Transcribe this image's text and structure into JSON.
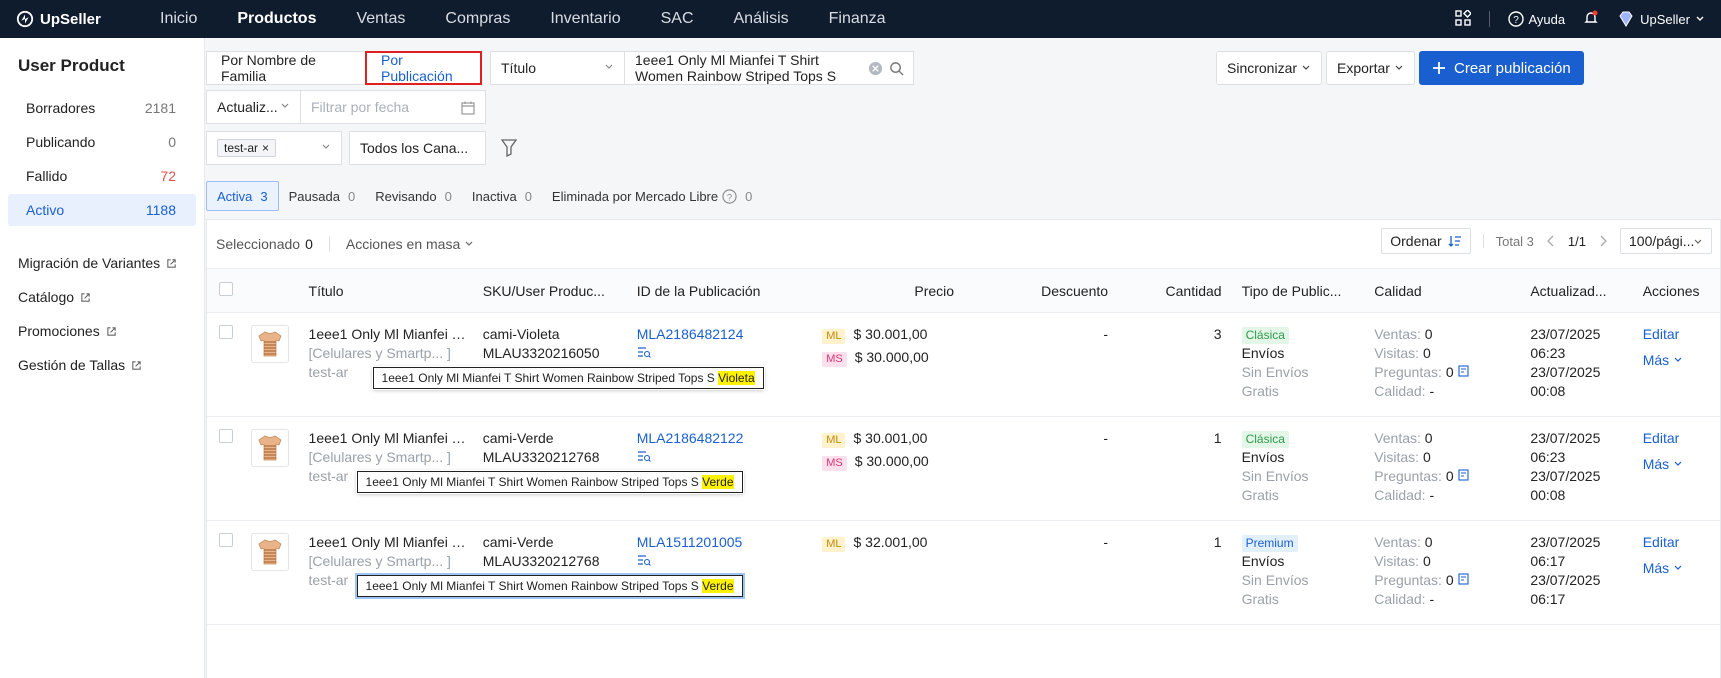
{
  "topbar": {
    "brand": "UpSeller",
    "nav": [
      "Inicio",
      "Productos",
      "Ventas",
      "Compras",
      "Inventario",
      "SAC",
      "Análisis",
      "Finanza"
    ],
    "active_nav": "Productos",
    "help": "Ayuda",
    "account": "UpSeller"
  },
  "sidebar": {
    "title": "User Product",
    "items": [
      {
        "label": "Borradores",
        "count": "2181"
      },
      {
        "label": "Publicando",
        "count": "0"
      },
      {
        "label": "Fallido",
        "count": "72"
      },
      {
        "label": "Activo",
        "count": "1188"
      }
    ],
    "links": [
      "Migración de Variantes",
      "Catálogo",
      "Promociones",
      "Gestión de Tallas"
    ]
  },
  "filters": {
    "toggle_family": "Por Nombre de Familia",
    "toggle_publication": "Por Publicación",
    "search_field": "Título",
    "search_value": "1eee1 Only Ml Mianfei T Shirt Women Rainbow Striped Tops S",
    "date_field": "Actualiz...",
    "date_placeholder": "Filtrar por fecha",
    "store_tag": "test-ar",
    "channel": "Todos los Cana..."
  },
  "actions": {
    "sync": "Sincronizar",
    "export": "Exportar",
    "create": "Crear publicación"
  },
  "tabs": [
    {
      "label": "Activa",
      "count": "3"
    },
    {
      "label": "Pausada",
      "count": "0"
    },
    {
      "label": "Revisando",
      "count": "0"
    },
    {
      "label": "Inactiva",
      "count": "0"
    },
    {
      "label": "Eliminada por Mercado Libre",
      "count": "0"
    }
  ],
  "toolbar": {
    "selected_label": "Seleccionado",
    "selected_count": "0",
    "bulk": "Acciones en masa",
    "order": "Ordenar",
    "total": "Total 3",
    "page": "1/1",
    "page_size": "100/pági..."
  },
  "table": {
    "columns": [
      "Título",
      "SKU/User Produc...",
      "ID de la Publicación",
      "Precio",
      "Descuento",
      "Cantidad",
      "Tipo de Public...",
      "Calidad",
      "Actualizad...",
      "Acciones"
    ],
    "rows": [
      {
        "title": "1eee1 Only Ml Mianfei T Shirt Women Rainbow Striped Tops S Violeta",
        "category": "[Celulares y Smartp... ]",
        "store": "test-ar",
        "sku": "cami-Violeta",
        "up_id": "MLAU3320216050",
        "pub_id": "MLA2186482124",
        "prices": [
          {
            "platform": "ML",
            "value": "$ 30.001,00"
          },
          {
            "platform": "MS",
            "value": "$ 30.000,00"
          }
        ],
        "discount": "-",
        "qty": "3",
        "type": "Clásica",
        "shipping": [
          "Envíos",
          "Sin Envíos",
          "Gratis"
        ],
        "quality": {
          "ventas": "0",
          "visitas": "0",
          "preguntas": "0",
          "calidad": "-"
        },
        "dates": [
          "23/07/2025",
          "06:23",
          "23/07/2025",
          "00:08"
        ],
        "tooltip_prefix": "1eee1 Only Ml Mianfei T Shirt Women Rainbow Striped Tops S",
        "tooltip_variant": "Violeta"
      },
      {
        "title": "1eee1 Only Ml Mianfei T Shirt Women Rainbow Striped Tops S Verde",
        "category": "[Celulares y Smartp... ]",
        "store": "test-ar",
        "sku": "cami-Verde",
        "up_id": "MLAU3320212768",
        "pub_id": "MLA2186482122",
        "prices": [
          {
            "platform": "ML",
            "value": "$ 30.001,00"
          },
          {
            "platform": "MS",
            "value": "$ 30.000,00"
          }
        ],
        "discount": "-",
        "qty": "1",
        "type": "Clásica",
        "shipping": [
          "Envíos",
          "Sin Envíos",
          "Gratis"
        ],
        "quality": {
          "ventas": "0",
          "visitas": "0",
          "preguntas": "0",
          "calidad": "-"
        },
        "dates": [
          "23/07/2025",
          "06:23",
          "23/07/2025",
          "00:08"
        ],
        "tooltip_prefix": "1eee1 Only Ml Mianfei T Shirt Women Rainbow Striped Tops S",
        "tooltip_variant": "Verde"
      },
      {
        "title": "1eee1 Only Ml Mianfei T Shirt Women Rainbow Striped Tops S Verde",
        "category": "[Celulares y Smartp... ]",
        "store": "test-ar",
        "sku": "cami-Verde",
        "up_id": "MLAU3320212768",
        "pub_id": "MLA1511201005",
        "prices": [
          {
            "platform": "ML",
            "value": "$ 32.001,00"
          }
        ],
        "discount": "-",
        "qty": "1",
        "type": "Premium",
        "shipping": [
          "Envíos",
          "Sin Envíos",
          "Gratis"
        ],
        "quality": {
          "ventas": "0",
          "visitas": "0",
          "preguntas": "0",
          "calidad": "-"
        },
        "dates": [
          "23/07/2025",
          "06:17",
          "23/07/2025",
          "06:17"
        ],
        "tooltip_prefix": "1eee1 Only Ml Mianfei T Shirt Women Rainbow Striped Tops S",
        "tooltip_variant": "Verde"
      }
    ],
    "labels": {
      "ventas": "Ventas:",
      "visitas": "Visitas:",
      "preguntas": "Preguntas:",
      "calidad": "Calidad:",
      "edit": "Editar",
      "more": "Más"
    }
  },
  "colors": {
    "accent": "#1a5fd0",
    "nav_bg": "#0f1c2e",
    "highlight": "#fff200",
    "error": "#e34d4d"
  }
}
